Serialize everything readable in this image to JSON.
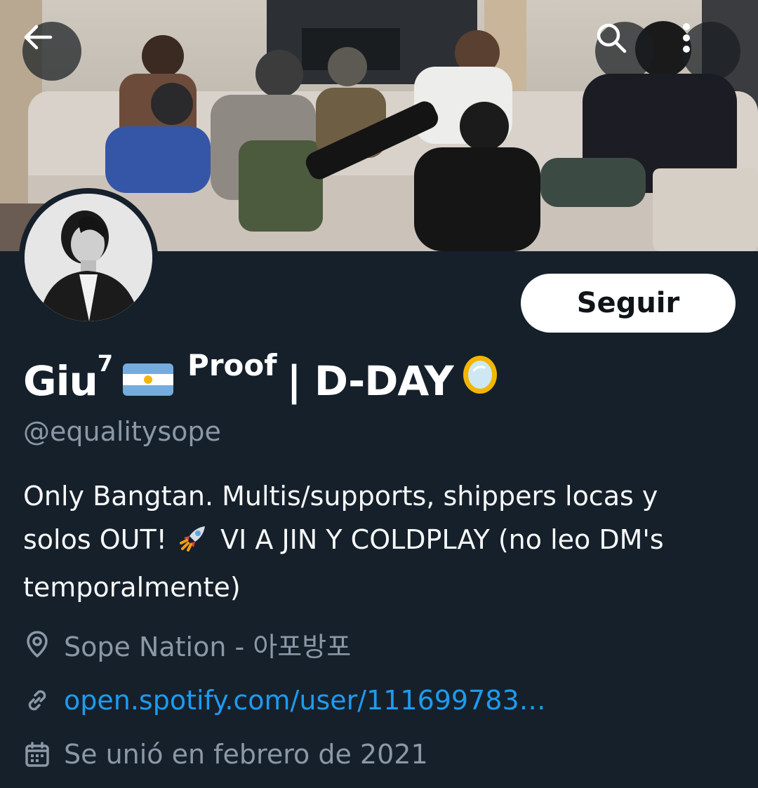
{
  "header": {
    "back_icon": "arrow-left-icon",
    "search_icon": "search-icon",
    "more_icon": "more-vertical-icon"
  },
  "profile": {
    "follow_label": "Seguir",
    "name_prefix": "Giu",
    "name_superscript": "7",
    "name_flag": "argentina-flag-icon",
    "name_proof": "Proof",
    "name_suffix": "| D-DAY",
    "name_emoji": "mirror-icon",
    "handle": "@equalitysope",
    "bio_line1": "Only Bangtan. Multis/supports, shippers locas y",
    "bio_line2_a": "solos OUT!",
    "bio_line2_b": "VI A JIN Y COLDPLAY (no leo DM's",
    "bio_line3": "temporalmente)",
    "location": "Sope Nation - 아포방포",
    "link": "open.spotify.com/user/111699783…",
    "joined": "Se unió en febrero de 2021"
  },
  "colors": {
    "background": "#15202b",
    "secondary_text": "#8b98a5",
    "link": "#1d9bf0",
    "button_bg": "#ffffff"
  }
}
